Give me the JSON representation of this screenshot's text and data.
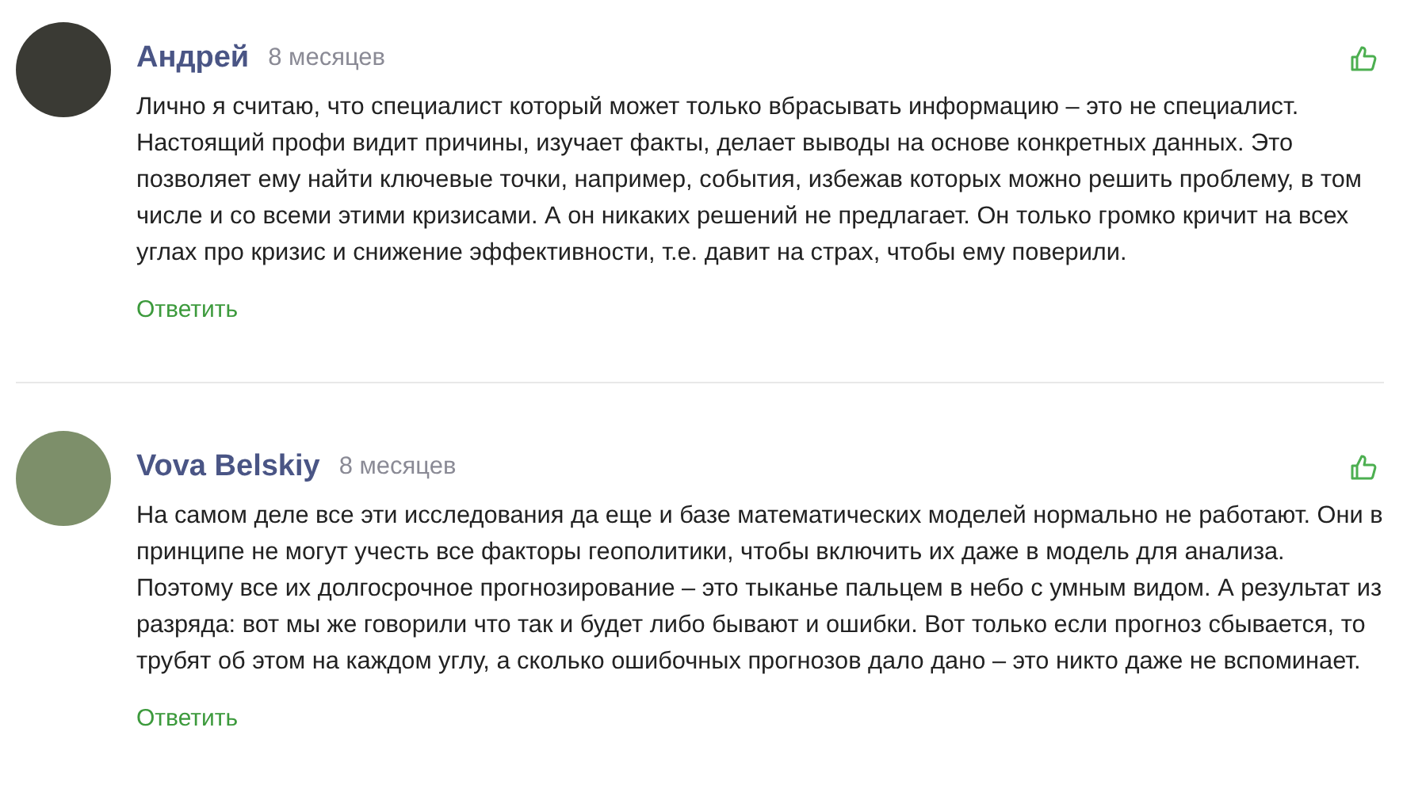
{
  "comments": [
    {
      "author": "Андрей",
      "time": "8 месяцев",
      "text": "Лично я считаю, что специалист который может только вбрасывать информацию – это не специалист. Настоящий профи видит причины, изучает факты, делает выводы на основе конкретных данных. Это позволяет ему найти ключевые точки, например, события, избежав которых можно решить проблему, в том числе и со всеми этими кризисами. А он никаких решений не предлагает. Он только громко кричит на всех углах про кризис и снижение эффективности, т.е. давит на страх, чтобы ему поверили.",
      "reply": "Ответить"
    },
    {
      "author": "Vova Belskiy",
      "time": "8 месяцев",
      "text": "На самом деле все эти исследования да еще и базе математических моделей нормально не работают. Они в принципе не могут учесть все факторы геополитики, чтобы включить их даже в модель для анализа. Поэтому все их долгосрочное прогнозирование – это тыканье пальцем в небо с умным видом. А результат из разряда: вот мы же говорили что так и будет либо бывают и ошибки. Вот только если прогноз сбывается, то трубят об этом на каждом углу, а сколько ошибочных прогнозов дало дано – это никто даже не вспоминает.",
      "reply": "Ответить"
    }
  ]
}
